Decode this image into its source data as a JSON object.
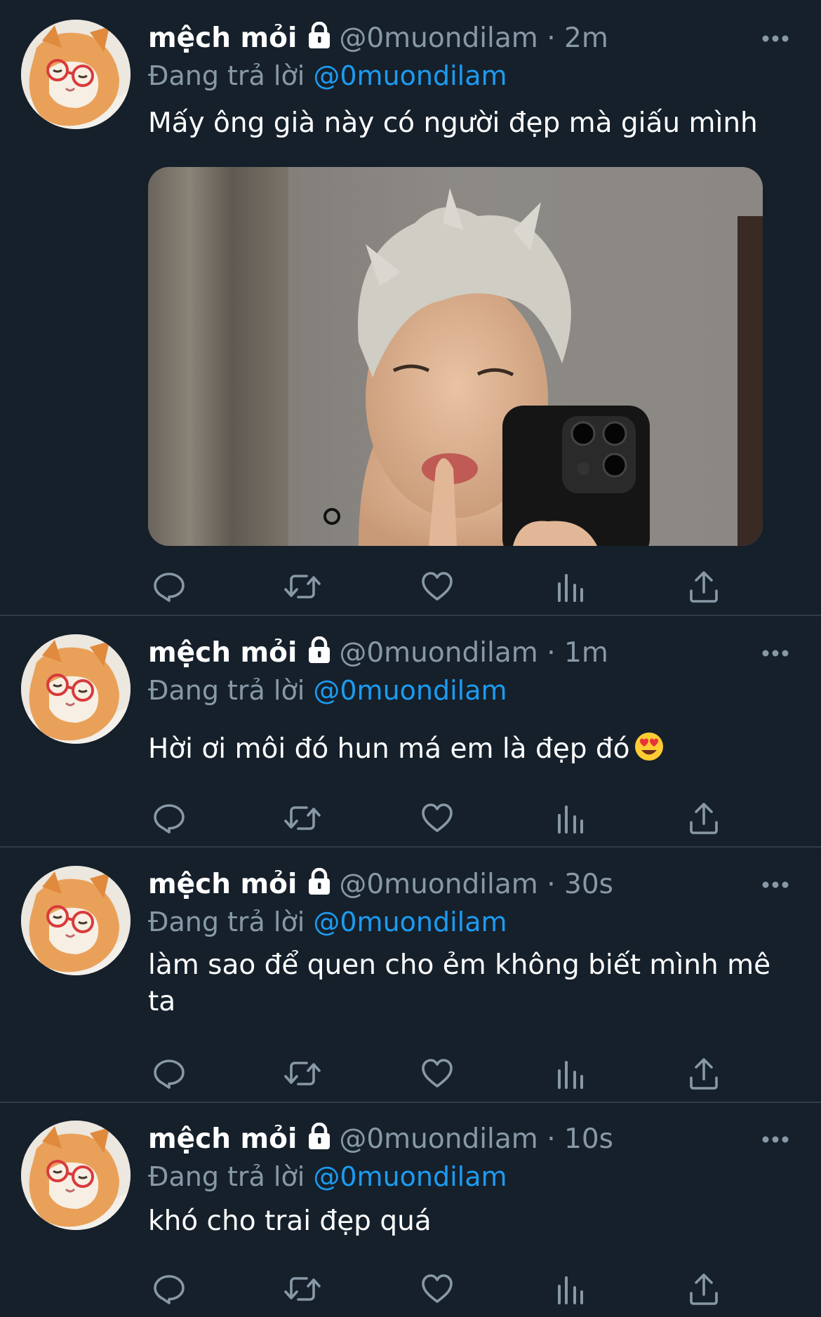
{
  "theme": {
    "background": "#15202b",
    "accent": "#1d9bf0",
    "muted": "#8899a6",
    "divider": "#2f3d4a"
  },
  "tweets": [
    {
      "display_name": "mệch mỏi",
      "handle": "@0muondilam",
      "separator": "·",
      "time": "2m",
      "replying_prefix": "Đang trả lời",
      "replying_to": "@0muondilam",
      "text": "Mấy ông già này có người đẹp mà giấu mình",
      "has_media": true,
      "icons": [
        "lock-icon",
        "more-icon",
        "reply-icon",
        "retweet-icon",
        "like-icon",
        "analytics-icon",
        "share-icon"
      ]
    },
    {
      "display_name": "mệch mỏi",
      "handle": "@0muondilam",
      "separator": "·",
      "time": "1m",
      "replying_prefix": "Đang trả lời",
      "replying_to": "@0muondilam",
      "text": "Hời ơi môi đó hun má em là đẹp đó",
      "emoji": "smiling-face-with-heart-eyes"
    },
    {
      "display_name": "mệch mỏi",
      "handle": "@0muondilam",
      "separator": "·",
      "time": "30s",
      "replying_prefix": "Đang trả lời",
      "replying_to": "@0muondilam",
      "text": "làm sao để quen cho ẻm không biết mình mê ta"
    },
    {
      "display_name": "mệch mỏi",
      "handle": "@0muondilam",
      "separator": "·",
      "time": "10s",
      "replying_prefix": "Đang trả lời",
      "replying_to": "@0muondilam",
      "text": "khó cho trai đẹp quá"
    }
  ]
}
